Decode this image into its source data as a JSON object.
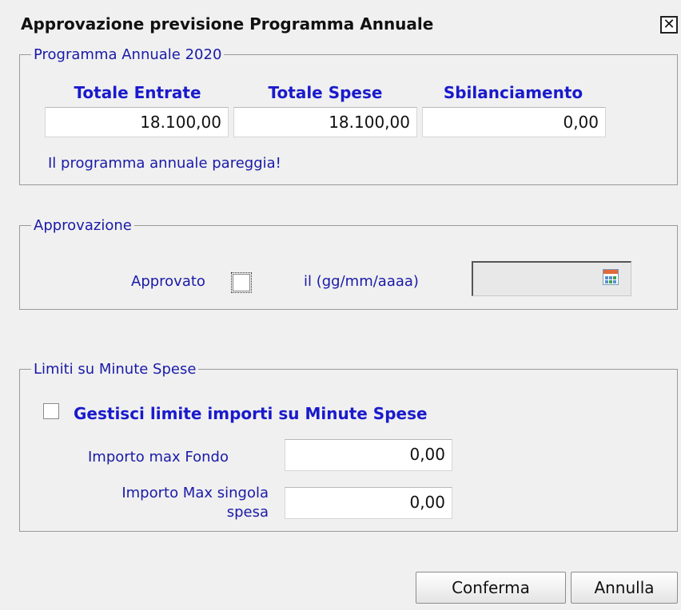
{
  "dialog": {
    "title": "Approvazione previsione Programma Annuale",
    "close_symbol": "✕"
  },
  "programma": {
    "legend": "Programma Annuale 2020",
    "headers": {
      "entrate": "Totale Entrate",
      "spese": "Totale Spese",
      "sbilanciamento": "Sbilanciamento"
    },
    "values": {
      "entrate": "18.100,00",
      "spese": "18.100,00",
      "sbilanciamento": "0,00"
    },
    "message": "Il programma annuale pareggia!"
  },
  "approvazione": {
    "legend": "Approvazione",
    "approvato_label": "Approvato",
    "approvato_checked": false,
    "date_label": "il (gg/mm/aaaa)",
    "date_value": "",
    "calendar_icon": "calendar-icon"
  },
  "minute_spese": {
    "legend": "Limiti su Minute Spese",
    "gestisci_label": "Gestisci limite importi su Minute Spese",
    "gestisci_checked": false,
    "importo_fondo_label": "Importo max Fondo",
    "importo_fondo_value": "0,00",
    "importo_singola_label_line1": "Importo Max singola",
    "importo_singola_label_line2": "spesa",
    "importo_singola_value": "0,00"
  },
  "buttons": {
    "confirm": "Conferma",
    "cancel": "Annulla"
  }
}
